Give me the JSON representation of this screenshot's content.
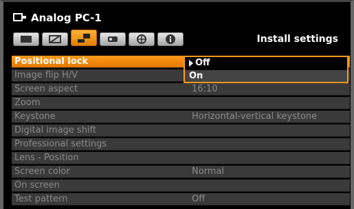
{
  "header": {
    "title": "Analog PC-1",
    "source_icon": "analog-pc-icon"
  },
  "tabs": [
    {
      "icon": "image-icon"
    },
    {
      "icon": "image-adjust-icon"
    },
    {
      "icon": "install-icon",
      "active": true
    },
    {
      "icon": "system-icon"
    },
    {
      "icon": "network-icon"
    },
    {
      "icon": "info-icon"
    }
  ],
  "tab_title": "Install settings",
  "menu": [
    {
      "label": "Positional lock",
      "value": ""
    },
    {
      "label": "Image flip H/V",
      "value": ""
    },
    {
      "label": "Screen aspect",
      "value": "16:10"
    },
    {
      "label": "Zoom",
      "value": ""
    },
    {
      "label": "Keystone",
      "value": "Horizontal-vertical keystone"
    },
    {
      "label": "Digital image shift",
      "value": ""
    },
    {
      "label": "Professional settings",
      "value": ""
    },
    {
      "label": "Lens - Position",
      "value": ""
    },
    {
      "label": "Screen color",
      "value": "Normal"
    },
    {
      "label": "On screen",
      "value": ""
    },
    {
      "label": "Test pattern",
      "value": "Off"
    }
  ],
  "dropdown": {
    "options": [
      "Off",
      "On"
    ],
    "selected": "Off"
  },
  "colors": {
    "accent": "#ff9a1a",
    "row_bg": "#3a3a3a",
    "dim_text": "#8a8a8a"
  }
}
